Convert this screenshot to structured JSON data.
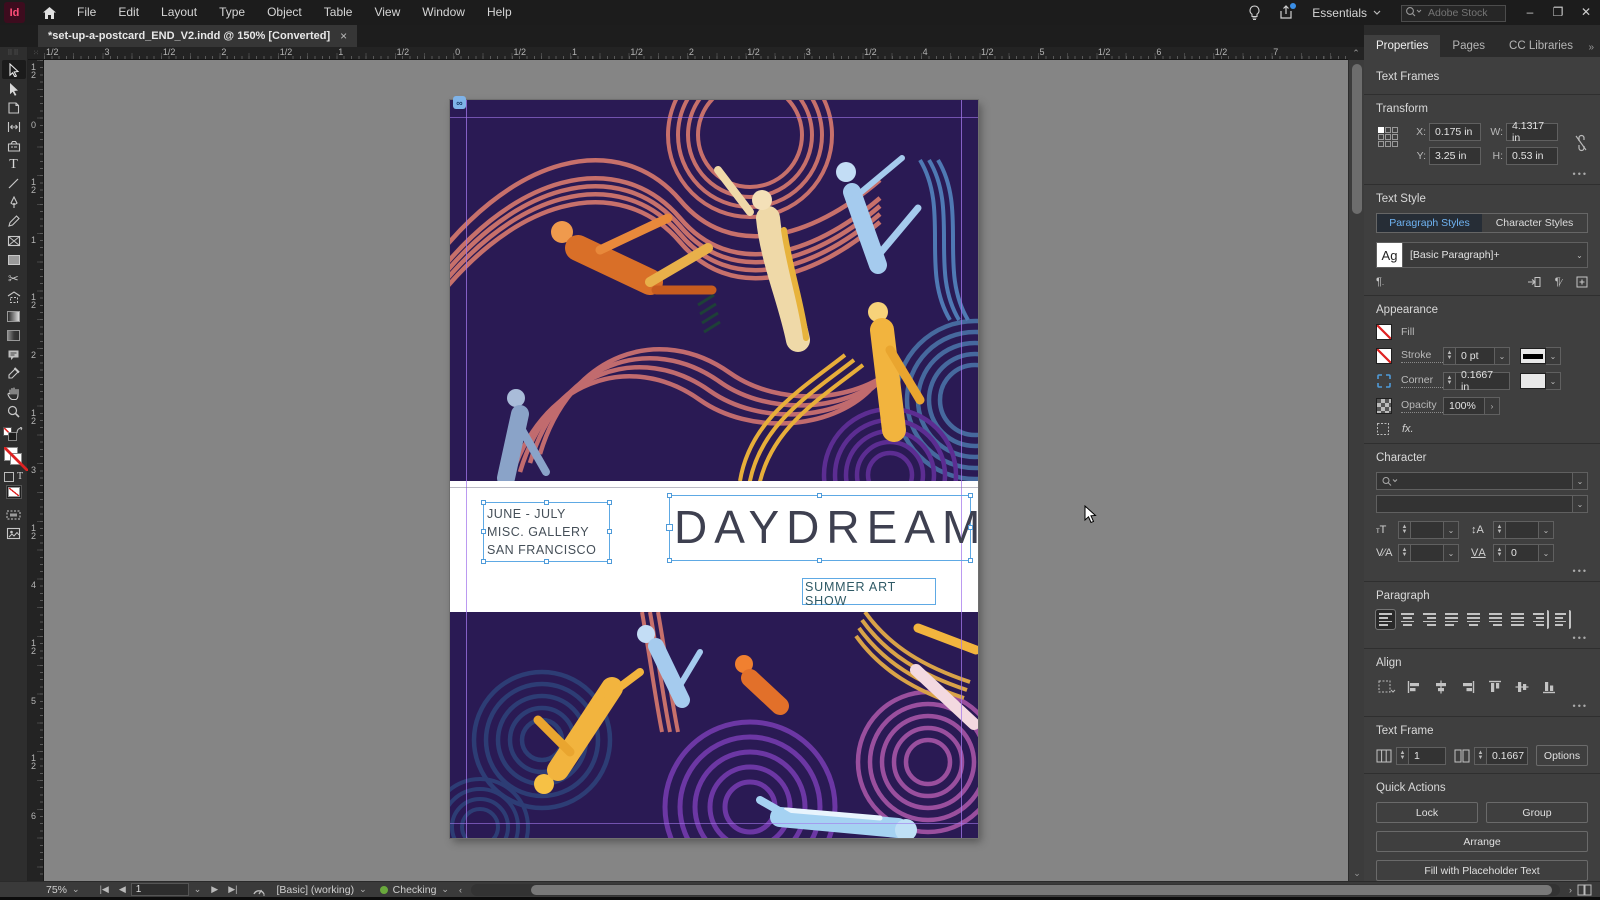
{
  "app": {
    "name": "Id",
    "workspace": "Essentials",
    "stock_search_placeholder": "Adobe Stock"
  },
  "menu": {
    "items": [
      "File",
      "Edit",
      "Layout",
      "Type",
      "Object",
      "Table",
      "View",
      "Window",
      "Help"
    ]
  },
  "document": {
    "tab_title": "*set-up-a-postcard_END_V2.indd @ 150% [Converted]",
    "close_glyph": "×"
  },
  "panel_tabs": {
    "items": [
      "Properties",
      "Pages",
      "CC Libraries"
    ],
    "active": "Properties"
  },
  "rulers": {
    "horizontal": [
      "1/2",
      "3",
      "1/2",
      "2",
      "1/2",
      "1",
      "1/2",
      "0",
      "1/2",
      "1",
      "1/2",
      "2",
      "1/2",
      "3",
      "1/2",
      "4",
      "1/2",
      "5",
      "1/2",
      "6",
      "1/2",
      "7"
    ],
    "vertical": [
      "1\n2",
      "0",
      "1\n2",
      "1",
      "1\n2",
      "2",
      "1\n2",
      "3",
      "1\n2",
      "4",
      "1\n2",
      "5",
      "1\n2",
      "6"
    ]
  },
  "artboard": {
    "headline": "DAYDREAM",
    "detail_lines": [
      "JUNE - JULY",
      "MISC. GALLERY",
      "SAN FRANCISCO"
    ],
    "subtitle": "SUMMER ART SHOW",
    "cc_badge": "∞"
  },
  "properties": {
    "selection_label": "Text Frames",
    "transform": {
      "title": "Transform",
      "x_label": "X:",
      "x_value": "0.175 in",
      "y_label": "Y:",
      "y_value": "3.25 in",
      "w_label": "W:",
      "w_value": "4.1317 in",
      "h_label": "H:",
      "h_value": "0.53 in"
    },
    "text_style": {
      "title": "Text Style",
      "paragraph_tab": "Paragraph Styles",
      "character_tab": "Character Styles",
      "sample": "Ag",
      "style_name": "[Basic Paragraph]+"
    },
    "appearance": {
      "title": "Appearance",
      "fill_label": "Fill",
      "stroke_label": "Stroke",
      "stroke_weight": "0 pt",
      "corner_label": "Corner",
      "corner_value": "0.1667 in",
      "opacity_label": "Opacity",
      "opacity_value": "100%",
      "fx_label": "fx."
    },
    "character": {
      "title": "Character",
      "tracking_value": "0"
    },
    "paragraph": {
      "title": "Paragraph"
    },
    "align": {
      "title": "Align"
    },
    "text_frame": {
      "title": "Text Frame",
      "columns_value": "1",
      "gutter_value": "0.1667",
      "options_label": "Options"
    },
    "quick_actions": {
      "title": "Quick Actions",
      "lock": "Lock",
      "group": "Group",
      "arrange": "Arrange",
      "fill_placeholder": "Fill with Placeholder Text"
    }
  },
  "status_bar": {
    "zoom_level": "75%",
    "page_number": "1",
    "preset": "[Basic] (working)",
    "preflight_status": "Checking"
  },
  "colors": {
    "selection_blue": "#5ea9e4",
    "artwork_bg": "#2a1a54",
    "accent_text_blue": "#6fb3f2",
    "pasteboard": "#858585"
  }
}
